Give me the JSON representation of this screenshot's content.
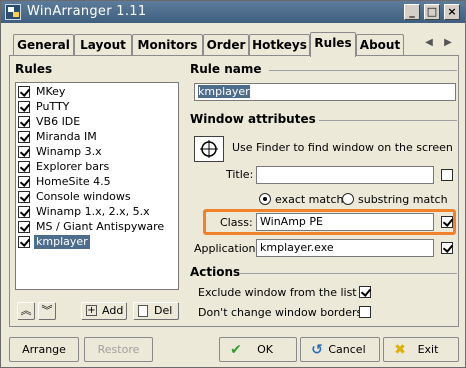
{
  "window": {
    "title": "WinArranger 1.11"
  },
  "titlebar_buttons": {
    "minimize": "_",
    "maximize": "□",
    "close": "×"
  },
  "tabs": [
    {
      "label": "General"
    },
    {
      "label": "Layout"
    },
    {
      "label": "Monitors"
    },
    {
      "label": "Order"
    },
    {
      "label": "Hotkeys"
    },
    {
      "label": "Rules"
    },
    {
      "label": "About"
    }
  ],
  "tab_scroll": {
    "left": "◀",
    "right": "▶"
  },
  "rules": {
    "heading": "Rules",
    "items": [
      {
        "label": "MKey",
        "checked": true
      },
      {
        "label": "PuTTY",
        "checked": true
      },
      {
        "label": "VB6 IDE",
        "checked": true
      },
      {
        "label": "Miranda IM",
        "checked": true
      },
      {
        "label": "Winamp 3.x",
        "checked": true
      },
      {
        "label": "Explorer bars",
        "checked": true
      },
      {
        "label": "HomeSite 4.5",
        "checked": true
      },
      {
        "label": "Console windows",
        "checked": true
      },
      {
        "label": "Winamp 1.x, 2.x, 5.x",
        "checked": true
      },
      {
        "label": "MS / Giant Antispyware",
        "checked": true
      },
      {
        "label": "kmplayer",
        "checked": true,
        "selected": true
      }
    ],
    "move_up": "︽",
    "move_down": "︾",
    "add_label": "Add",
    "del_label": "Del"
  },
  "rule_name": {
    "heading": "Rule name",
    "value": "kmplayer"
  },
  "window_attributes": {
    "heading": "Window attributes",
    "finder_hint": "Use Finder to find window on the screen",
    "title_label": "Title:",
    "title_value": "",
    "title_checked": false,
    "exact_match": "exact match",
    "substring_match": "substring match",
    "class_label": "Class:",
    "class_value": "WinAmp PE",
    "class_checked": true,
    "application_label": "Application:",
    "application_value": "kmplayer.exe",
    "application_checked": true
  },
  "actions": {
    "heading": "Actions",
    "exclude_label": "Exclude window from the list",
    "exclude_checked": true,
    "dont_change_label": "Don't change window borders",
    "dont_change_checked": false
  },
  "footer": {
    "arrange": "Arrange",
    "restore": "Restore",
    "ok": "OK",
    "cancel": "Cancel",
    "exit": "Exit"
  },
  "colors": {
    "titlebar": "#4f6e8e",
    "selection": "#4e6d8c",
    "highlight_outline": "#f0822c",
    "ok_icon": "#2fa02f",
    "cancel_icon": "#2a6fbf",
    "exit_icon": "#e0b000"
  }
}
